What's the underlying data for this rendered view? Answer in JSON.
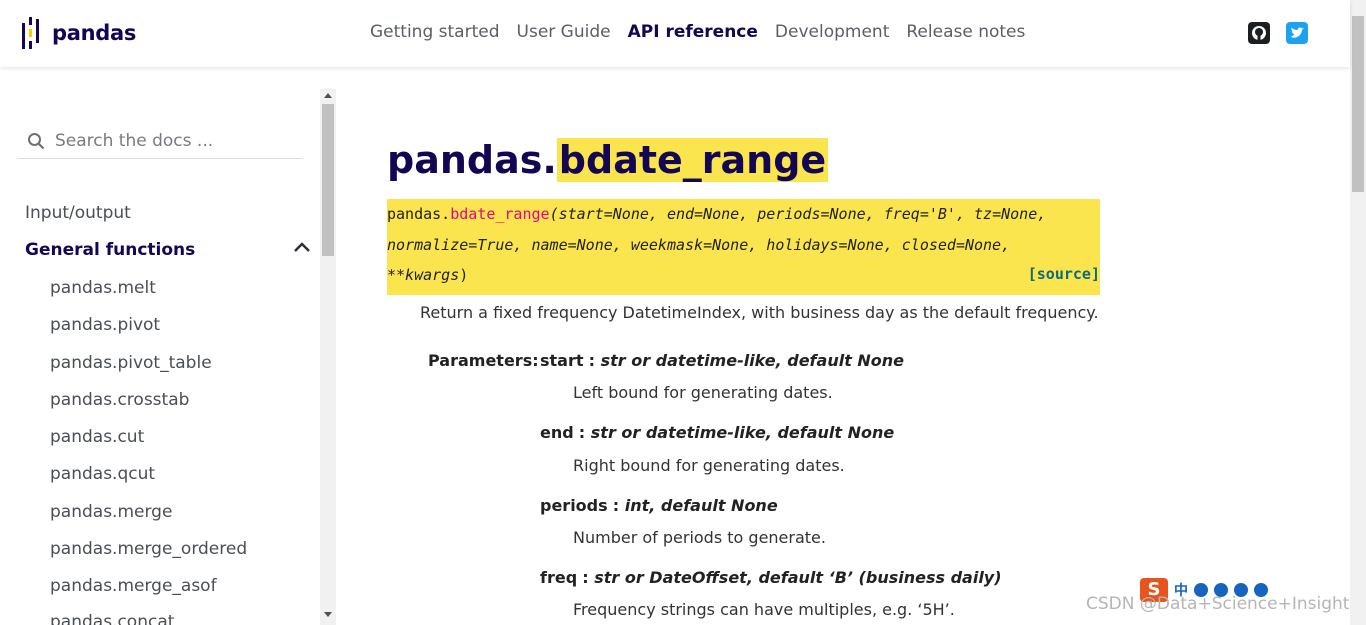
{
  "brand": {
    "name": "pandas"
  },
  "nav": {
    "links": [
      {
        "label": "Getting started",
        "active": false
      },
      {
        "label": "User Guide",
        "active": false
      },
      {
        "label": "API reference",
        "active": true
      },
      {
        "label": "Development",
        "active": false
      },
      {
        "label": "Release notes",
        "active": false
      }
    ],
    "icons": [
      "github-icon",
      "twitter-icon"
    ]
  },
  "sidebar": {
    "search_placeholder": "Search the docs ...",
    "sections": [
      {
        "label": "Input/output",
        "active": false
      },
      {
        "label": "General functions",
        "active": true,
        "expanded": true
      }
    ],
    "subitems": [
      "pandas.melt",
      "pandas.pivot",
      "pandas.pivot_table",
      "pandas.crosstab",
      "pandas.cut",
      "pandas.qcut",
      "pandas.merge",
      "pandas.merge_ordered",
      "pandas.merge_asof",
      "pandas.concat"
    ]
  },
  "content": {
    "title_prefix": "pandas.",
    "title_name": "bdate_range",
    "signature": {
      "module": "pandas.",
      "name": "bdate_range",
      "line1": "(start=None, end=None, periods=None, freq='B', tz=None,",
      "line2": "normalize=True, name=None, weekmask=None, holidays=None, closed=None,",
      "line3": "**kwargs",
      "close": ")",
      "source": "[source]"
    },
    "description": "Return a fixed frequency DatetimeIndex, with business day as the default frequency.",
    "parameters_label": "Parameters:",
    "parameters": [
      {
        "name": "start",
        "type": "str or datetime-like, default None",
        "desc": "Left bound for generating dates."
      },
      {
        "name": "end",
        "type": "str or datetime-like, default None",
        "desc": "Right bound for generating dates."
      },
      {
        "name": "periods",
        "type": "int, default None",
        "desc": "Number of periods to generate."
      },
      {
        "name": "freq",
        "type": "str or DateOffset, default ‘B’ (business daily)",
        "desc": "Frequency strings can have multiples, e.g. ‘5H’."
      }
    ]
  },
  "overlay": {
    "ime_logo": "S",
    "ime_lang": "中",
    "watermark": "CSDN @Data+Science+Insight"
  },
  "colors": {
    "brand": "#130754",
    "highlight": "#fbe54e",
    "func_name": "#e70488",
    "source_link": "#0f6a7b"
  }
}
